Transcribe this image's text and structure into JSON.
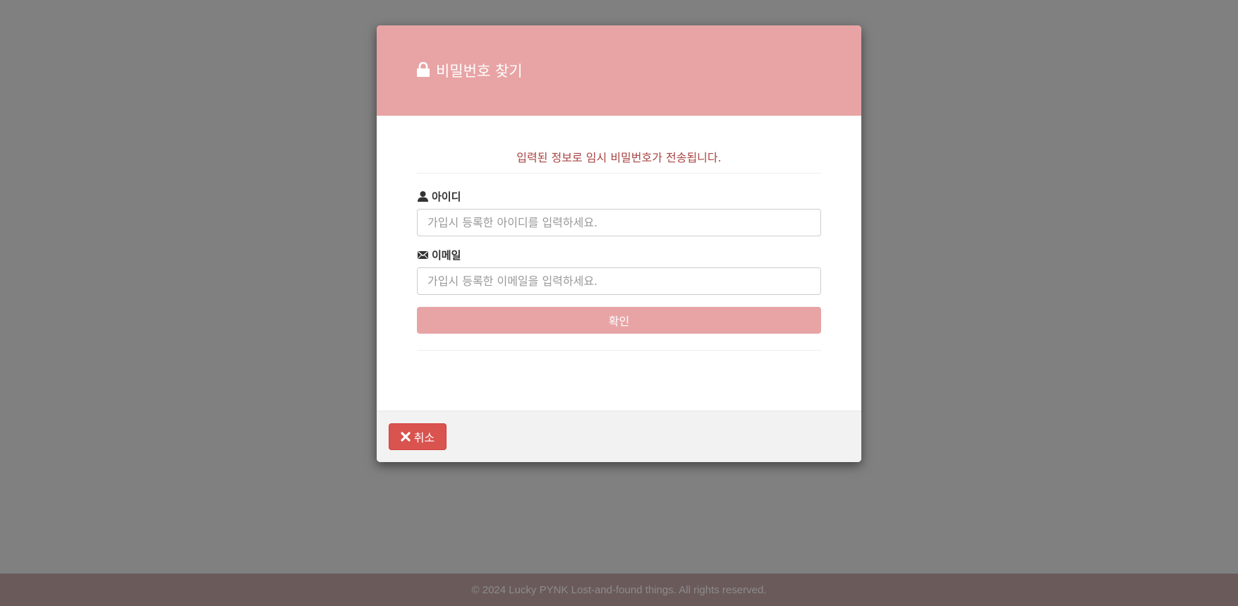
{
  "modal": {
    "title": "비밀번호 찾기",
    "title_icon": "lock-icon",
    "notice": "입력된 정보로 임시 비밀번호가 전송됩니다.",
    "fields": {
      "id": {
        "label": "아이디",
        "icon": "user-icon",
        "value": "",
        "placeholder": "가입시 등록한 아이디를 입력하세요."
      },
      "email": {
        "label": "이메일",
        "icon": "envelope-icon",
        "value": "",
        "placeholder": "가입시 등록한 이메일을 입력하세요."
      }
    },
    "confirm_label": "확인",
    "cancel_label": "취소",
    "cancel_icon": "close-icon"
  },
  "footer": {
    "text": "© 2024 Lucky PYNK Lost-and-found things. All rights reserved."
  },
  "colors": {
    "backdrop": "#808080",
    "header_accent": "#e8a4a5",
    "notice_text": "#a94442",
    "cancel_button": "#d9534f",
    "footer_bg": "#6b5a5a"
  }
}
